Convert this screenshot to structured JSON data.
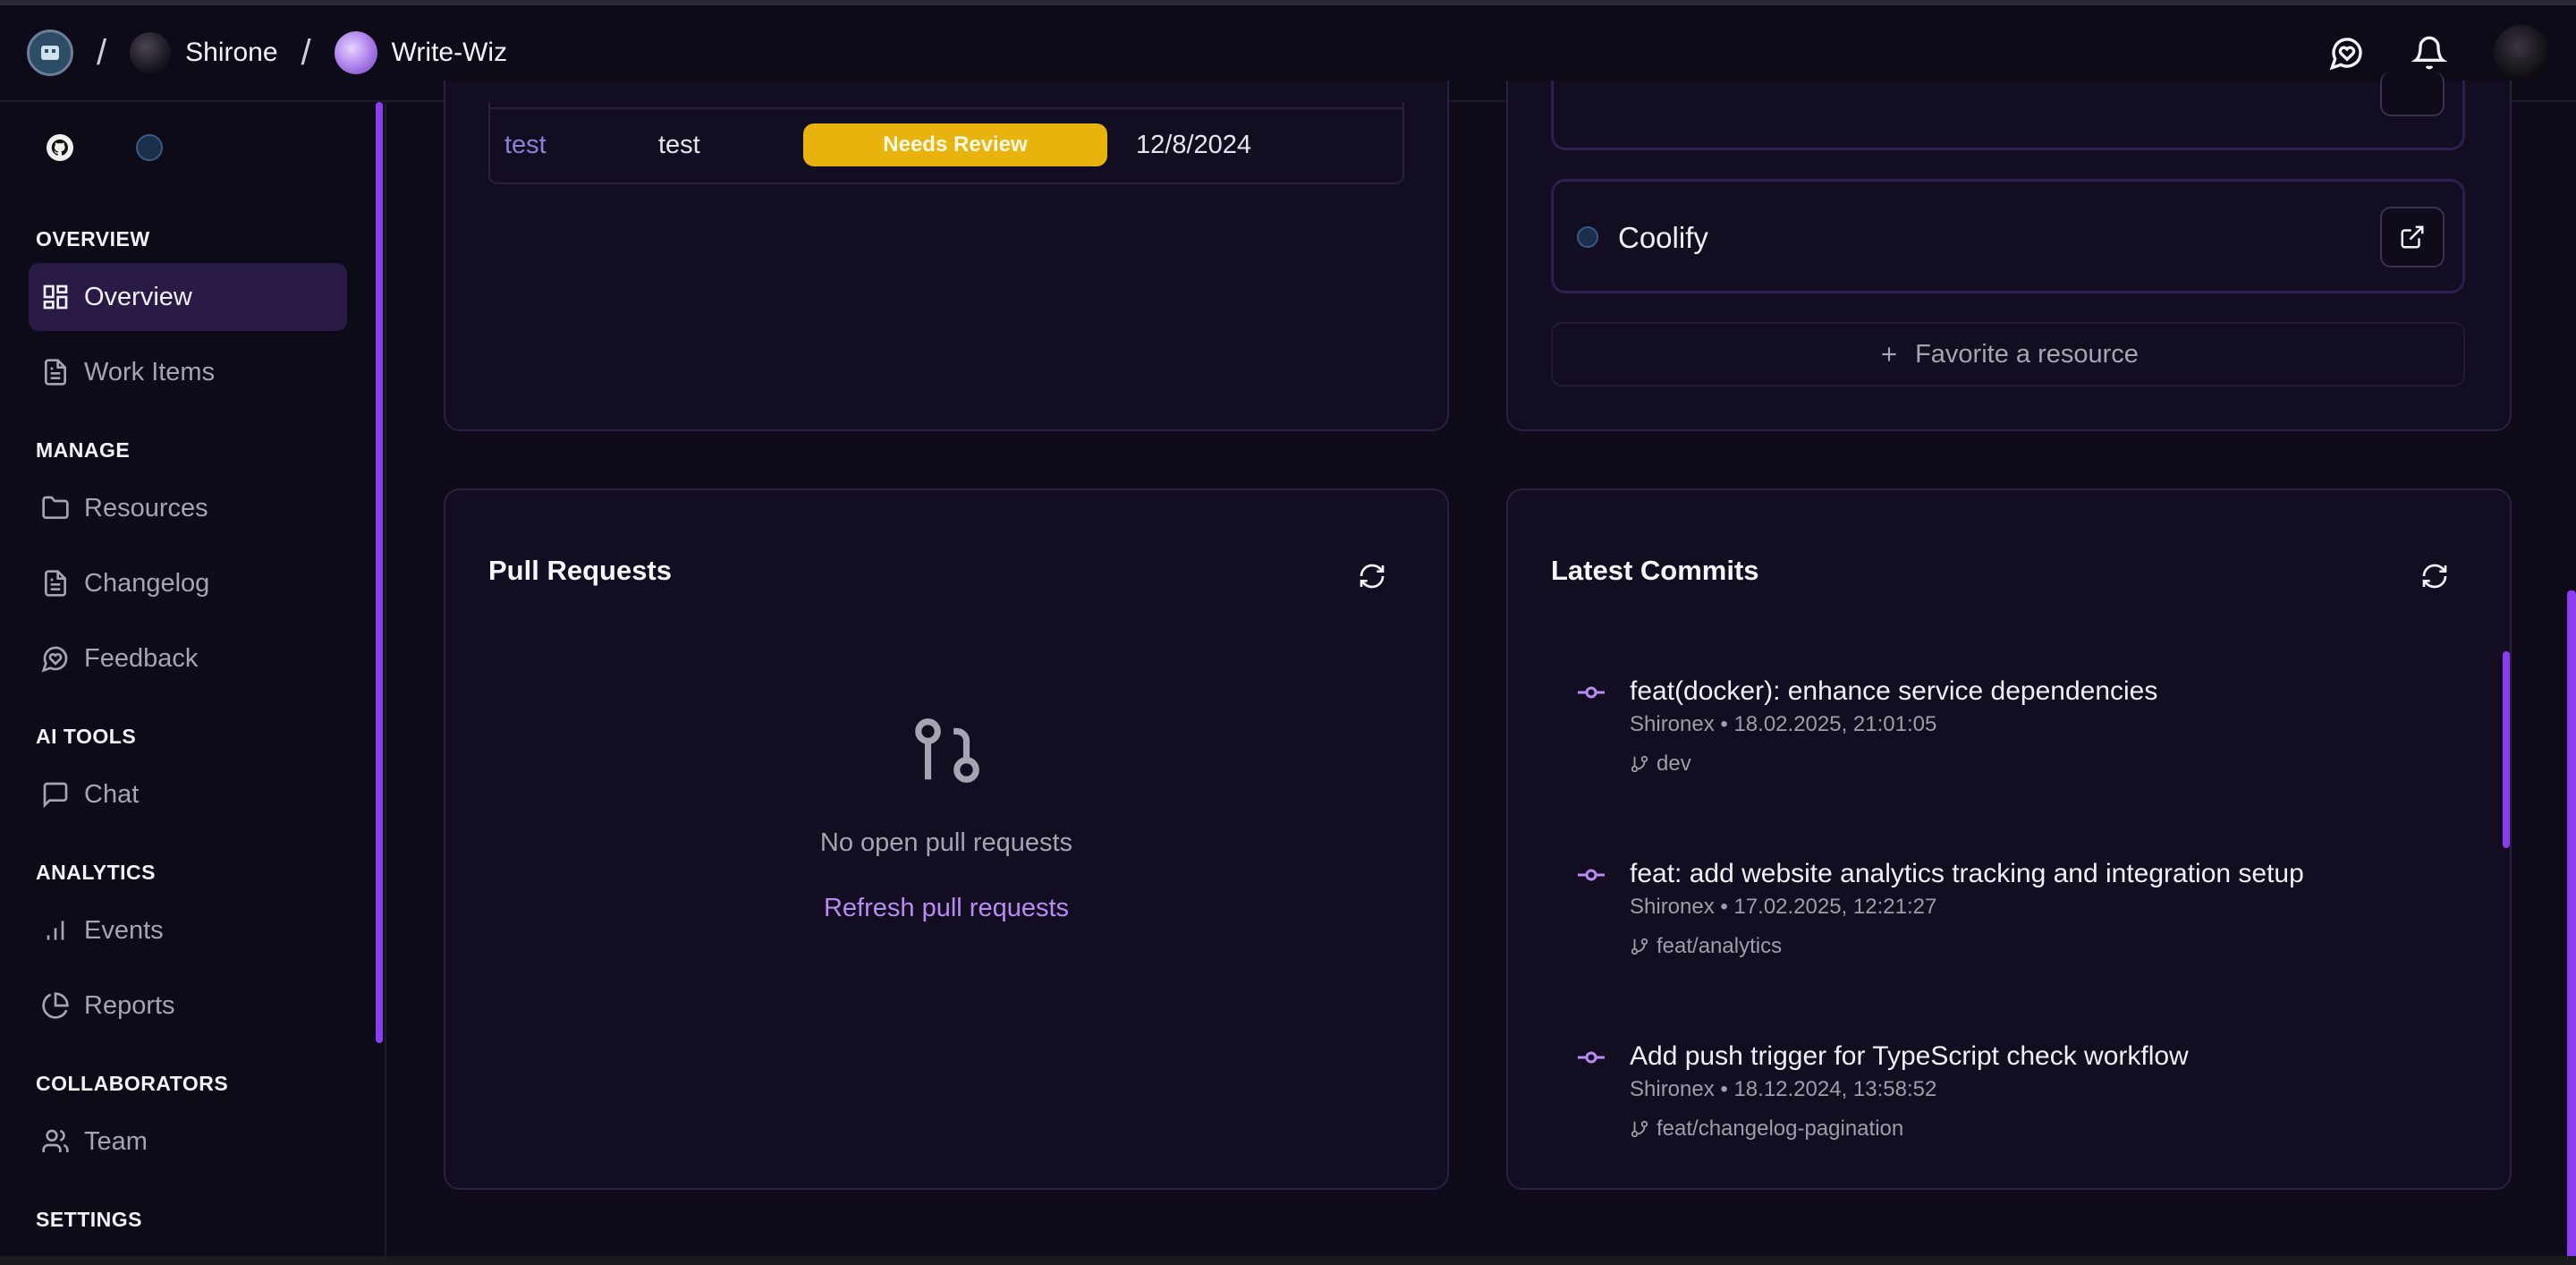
{
  "topbar": {
    "org_name": "Shirone",
    "project_name": "Write-Wiz",
    "separator": "/"
  },
  "sidebar": {
    "sections": {
      "overview": "OVERVIEW",
      "manage": "MANAGE",
      "ai_tools": "AI TOOLS",
      "analytics": "ANALYTICS",
      "collaborators": "COLLABORATORS",
      "settings": "SETTINGS"
    },
    "items": {
      "overview": "Overview",
      "work_items": "Work Items",
      "resources": "Resources",
      "changelog": "Changelog",
      "feedback": "Feedback",
      "chat": "Chat",
      "events": "Events",
      "reports": "Reports",
      "team": "Team"
    }
  },
  "work_items_table": {
    "row": {
      "title": "test",
      "description": "test",
      "status": "Needs Review",
      "date": "12/8/2024"
    },
    "colors": {
      "status_badge": "#e8b30c",
      "link": "#8f7fd8"
    }
  },
  "resources": {
    "items": [
      {
        "name": "Coolify",
        "icon": "coolify-icon"
      }
    ],
    "favorite_button": "Favorite a resource"
  },
  "pull_requests": {
    "title": "Pull Requests",
    "empty_text": "No open pull requests",
    "refresh_link": "Refresh pull requests"
  },
  "commits": {
    "title": "Latest Commits",
    "items": [
      {
        "message": "feat(docker): enhance service dependencies",
        "meta": "Shironex • 18.02.2025, 21:01:05",
        "branch": "dev"
      },
      {
        "message": "feat: add website analytics tracking and integration setup",
        "meta": "Shironex • 17.02.2025, 12:21:27",
        "branch": "feat/analytics"
      },
      {
        "message": "Add push trigger for TypeScript check workflow",
        "meta": "Shironex • 18.12.2024, 13:58:52",
        "branch": "feat/changelog-pagination"
      }
    ]
  },
  "theme": {
    "accent": "#8b3df0",
    "background": "#0f0b1a",
    "card": "#120d20"
  }
}
